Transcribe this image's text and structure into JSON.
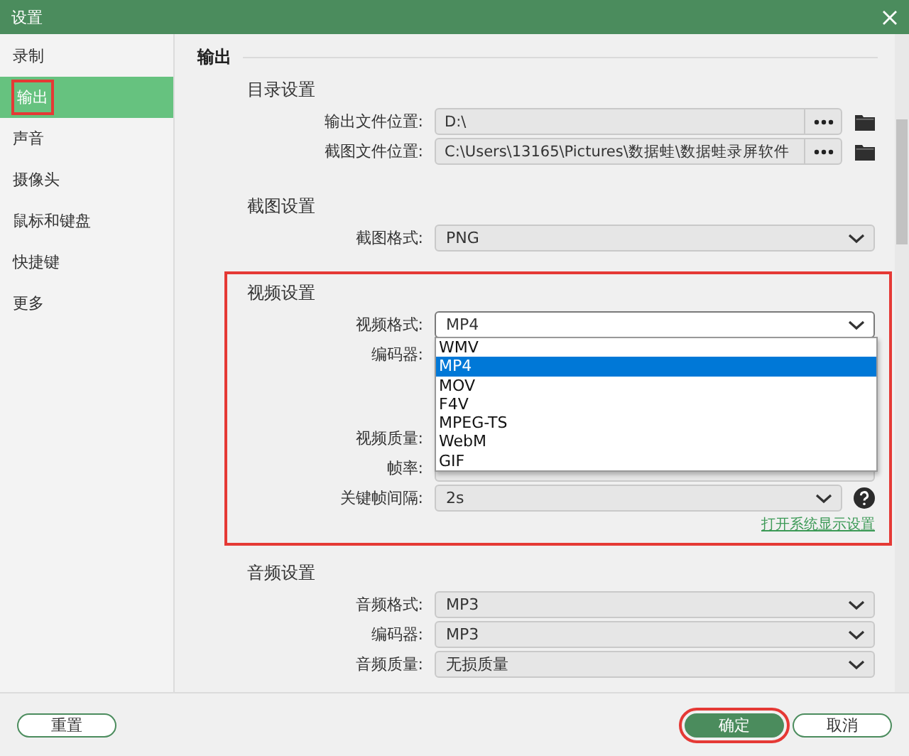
{
  "window": {
    "title": "设置"
  },
  "sidebar": {
    "items": [
      {
        "label": "录制",
        "selected": false,
        "highlighted": false
      },
      {
        "label": "输出",
        "selected": true,
        "highlighted": true
      },
      {
        "label": "声音",
        "selected": false,
        "highlighted": false
      },
      {
        "label": "摄像头",
        "selected": false,
        "highlighted": false
      },
      {
        "label": "鼠标和键盘",
        "selected": false,
        "highlighted": false
      },
      {
        "label": "快捷键",
        "selected": false,
        "highlighted": false
      },
      {
        "label": "更多",
        "selected": false,
        "highlighted": false
      }
    ]
  },
  "content": {
    "heading": "输出",
    "sections": [
      {
        "title": "目录设置",
        "highlighted": false,
        "rows": [
          {
            "kind": "path",
            "label": "输出文件位置:",
            "value": "D:\\"
          },
          {
            "kind": "path",
            "label": "截图文件位置:",
            "value": "C:\\Users\\13165\\Pictures\\数据蛙\\数据蛙录屏软件"
          }
        ]
      },
      {
        "title": "截图设置",
        "highlighted": false,
        "rows": [
          {
            "kind": "select",
            "label": "截图格式:",
            "value": "PNG"
          }
        ]
      },
      {
        "title": "视频设置",
        "highlighted": true,
        "link": "打开系统显示设置",
        "rows": [
          {
            "kind": "select",
            "label": "视频格式:",
            "value": "MP4",
            "open": true,
            "options": [
              {
                "label": "WMV",
                "selected": false
              },
              {
                "label": "MP4",
                "selected": true
              },
              {
                "label": "MOV",
                "selected": false
              },
              {
                "label": "F4V",
                "selected": false
              },
              {
                "label": "MPEG-TS",
                "selected": false
              },
              {
                "label": "WebM",
                "selected": false
              },
              {
                "label": "GIF",
                "selected": false
              }
            ]
          },
          {
            "kind": "label",
            "label": "编码器:"
          },
          {
            "kind": "covered"
          },
          {
            "kind": "label",
            "label": "视频质量:"
          },
          {
            "kind": "select",
            "label": "帧率:"
          },
          {
            "kind": "select",
            "label": "关键帧间隔:",
            "value": "2s",
            "help": true
          }
        ]
      },
      {
        "title": "音频设置",
        "highlighted": false,
        "rows": [
          {
            "kind": "select",
            "label": "音频格式:",
            "value": "MP3"
          },
          {
            "kind": "select",
            "label": "编码器:",
            "value": "MP3"
          },
          {
            "kind": "select",
            "label": "音频质量:",
            "value": "无损质量"
          }
        ]
      }
    ]
  },
  "footer": {
    "buttons": [
      {
        "label": "重置",
        "kind": "secondary",
        "highlighted": false
      },
      {
        "label": "确定",
        "kind": "primary",
        "highlighted": true
      },
      {
        "label": "取消",
        "kind": "secondary",
        "highlighted": false
      }
    ]
  }
}
